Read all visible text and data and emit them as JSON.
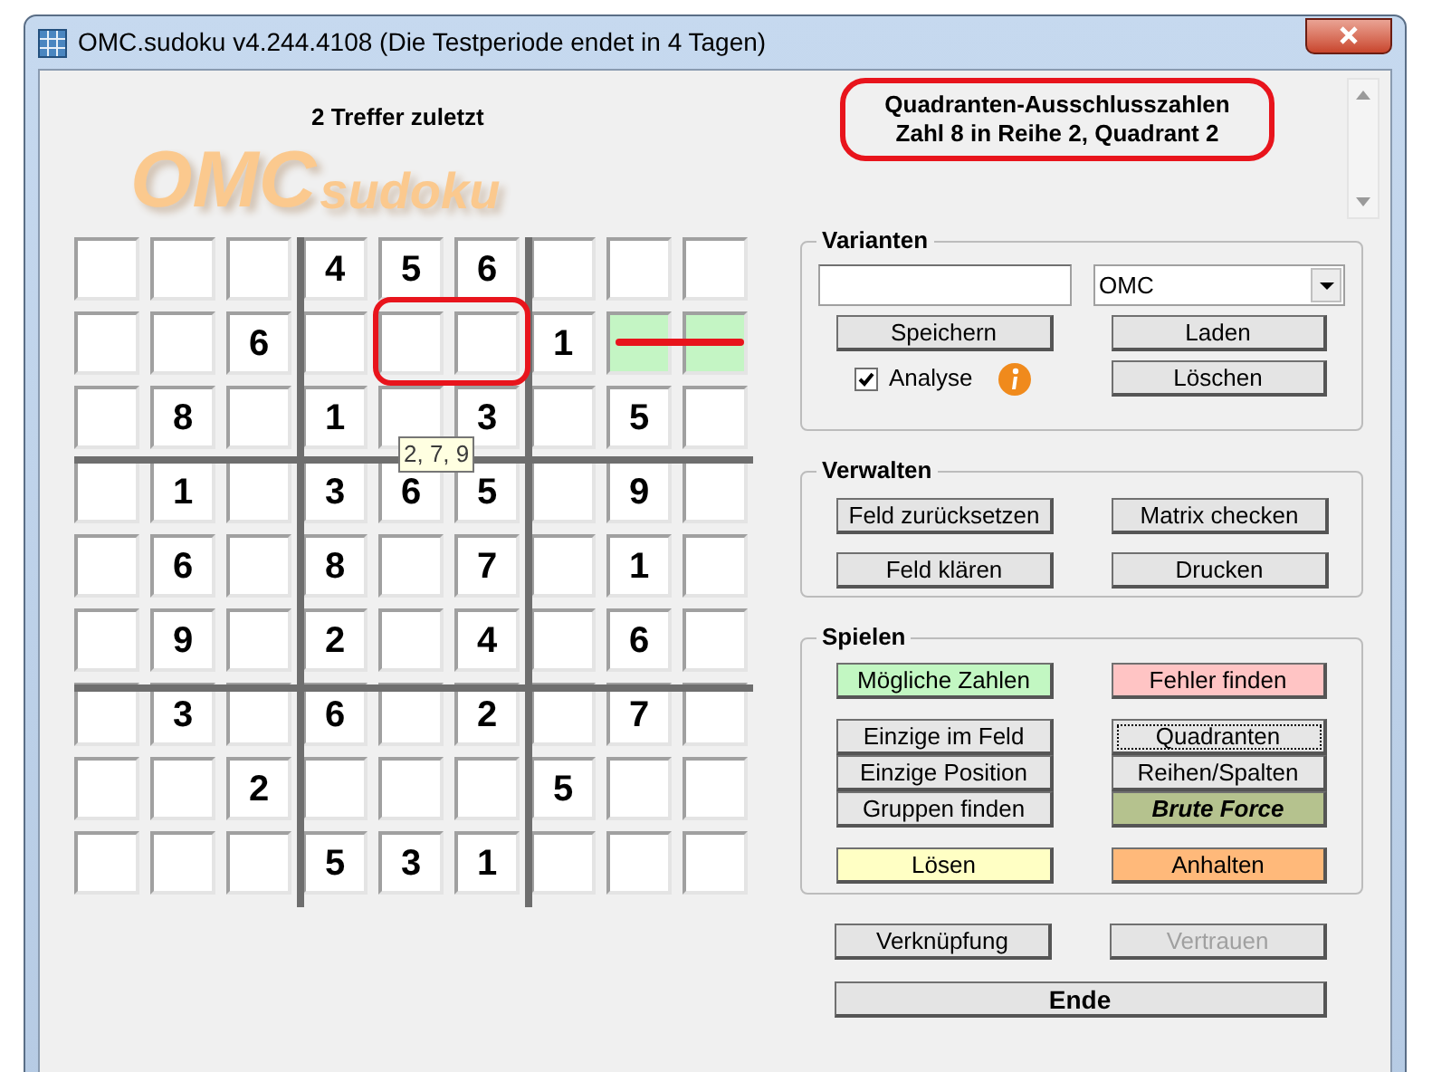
{
  "window": {
    "title": "OMC.sudoku v4.244.4108 (Die Testperiode endet in 4 Tagen)"
  },
  "logo": {
    "part_1": "OMC",
    "part_2": "sudoku"
  },
  "hits": "2 Treffer zuletzt",
  "message": {
    "line_1": "Quadranten-Ausschlusszahlen",
    "line_2": "Zahl 8 in Reihe 2, Quadrant 2"
  },
  "grid": {
    "rows": [
      [
        {
          "highlighted": false
        },
        {
          "highlighted": false
        },
        {
          "highlighted": false
        },
        {
          "value": "4",
          "highlighted": false
        },
        {
          "value": "5",
          "highlighted": false
        },
        {
          "value": "6",
          "highlighted": false
        },
        {
          "highlighted": false
        },
        {
          "highlighted": false
        },
        {
          "highlighted": false
        }
      ],
      [
        {
          "highlighted": false
        },
        {
          "highlighted": false
        },
        {
          "value": "6",
          "highlighted": false
        },
        {
          "highlighted": false
        },
        {
          "highlighted": false
        },
        {
          "highlighted": false
        },
        {
          "value": "1",
          "highlighted": false
        },
        {
          "highlighted": true
        },
        {
          "highlighted": true
        }
      ],
      [
        {
          "highlighted": false
        },
        {
          "value": "8",
          "highlighted": false
        },
        {
          "highlighted": false
        },
        {
          "value": "1",
          "highlighted": false
        },
        {
          "highlighted": false
        },
        {
          "value": "3",
          "highlighted": false
        },
        {
          "highlighted": false
        },
        {
          "value": "5",
          "highlighted": false
        },
        {
          "highlighted": false
        }
      ],
      [
        {
          "highlighted": false
        },
        {
          "value": "1",
          "highlighted": false
        },
        {
          "highlighted": false
        },
        {
          "value": "3",
          "highlighted": false
        },
        {
          "value": "6",
          "highlighted": false
        },
        {
          "value": "5",
          "highlighted": false
        },
        {
          "highlighted": false
        },
        {
          "value": "9",
          "highlighted": false
        },
        {
          "highlighted": false
        }
      ],
      [
        {
          "highlighted": false
        },
        {
          "value": "6",
          "highlighted": false
        },
        {
          "highlighted": false
        },
        {
          "value": "8",
          "highlighted": false
        },
        {
          "highlighted": false
        },
        {
          "value": "7",
          "highlighted": false
        },
        {
          "highlighted": false
        },
        {
          "value": "1",
          "highlighted": false
        },
        {
          "highlighted": false
        }
      ],
      [
        {
          "highlighted": false
        },
        {
          "value": "9",
          "highlighted": false
        },
        {
          "highlighted": false
        },
        {
          "value": "2",
          "highlighted": false
        },
        {
          "highlighted": false
        },
        {
          "value": "4",
          "highlighted": false
        },
        {
          "highlighted": false
        },
        {
          "value": "6",
          "highlighted": false
        },
        {
          "highlighted": false
        }
      ],
      [
        {
          "highlighted": false
        },
        {
          "value": "3",
          "highlighted": false
        },
        {
          "highlighted": false
        },
        {
          "value": "6",
          "highlighted": false
        },
        {
          "highlighted": false
        },
        {
          "value": "2",
          "highlighted": false
        },
        {
          "highlighted": false
        },
        {
          "value": "7",
          "highlighted": false
        },
        {
          "highlighted": false
        }
      ],
      [
        {
          "highlighted": false
        },
        {
          "highlighted": false
        },
        {
          "value": "2",
          "highlighted": false
        },
        {
          "highlighted": false
        },
        {
          "highlighted": false
        },
        {
          "highlighted": false
        },
        {
          "value": "5",
          "highlighted": false
        },
        {
          "highlighted": false
        },
        {
          "highlighted": false
        }
      ],
      [
        {
          "highlighted": false
        },
        {
          "highlighted": false
        },
        {
          "highlighted": false
        },
        {
          "value": "5",
          "highlighted": false
        },
        {
          "value": "3",
          "highlighted": false
        },
        {
          "value": "1",
          "highlighted": false
        },
        {
          "highlighted": false
        },
        {
          "highlighted": false
        },
        {
          "highlighted": false
        }
      ]
    ],
    "tooltip": "2, 7, 9"
  },
  "varianten": {
    "title": "Varianten",
    "dropdown": {
      "value": "OMC"
    },
    "buttons": [
      {
        "label": "Speichern"
      },
      {
        "label": "Laden"
      },
      {
        "label": "Löschen"
      }
    ],
    "analyse": {
      "label": "Analyse",
      "checked": true
    }
  },
  "verwalten": {
    "title": "Verwalten",
    "buttons": [
      {
        "label": "Feld zurücksetzen"
      },
      {
        "label": "Matrix checken"
      },
      {
        "label": "Feld klären"
      },
      {
        "label": "Drucken"
      }
    ]
  },
  "spielen": {
    "title": "Spielen",
    "groups": [
      {
        "rows": [
          [
            {
              "label": "Mögliche Zahlen",
              "color": "#c2f7c2",
              "kind": "plain",
              "focused": false
            },
            {
              "label": "Fehler finden",
              "color": "#ffc4c4",
              "kind": "plain",
              "focused": false
            }
          ]
        ]
      },
      {
        "rows": [
          [
            {
              "label": "Einzige im Feld",
              "color": "#e6e6e6",
              "kind": "plain",
              "focused": false
            },
            {
              "label": "Quadranten",
              "color": "#e6e6e6",
              "kind": "plain",
              "focused": true
            }
          ],
          [
            {
              "label": "Einzige Position",
              "color": "#e6e6e6",
              "kind": "plain",
              "focused": false
            },
            {
              "label": "Reihen/Spalten",
              "color": "#e6e6e6",
              "kind": "plain",
              "focused": false
            }
          ],
          [
            {
              "label": "Gruppen finden",
              "color": "#e6e6e6",
              "kind": "plain",
              "focused": false
            },
            {
              "label": "Brute Force",
              "color": "#b5c28e",
              "kind": "bold-italic",
              "focused": false
            }
          ]
        ]
      },
      {
        "rows": [
          [
            {
              "label": "Lösen",
              "color": "#ffffc4",
              "kind": "plain",
              "focused": false
            },
            {
              "label": "Anhalten",
              "color": "#ffb97a",
              "kind": "plain",
              "focused": false
            }
          ]
        ]
      }
    ]
  },
  "bottom_buttons": [
    {
      "label": "Verknüpfung",
      "disabled": false
    },
    {
      "label": "Vertrauen",
      "disabled": true
    }
  ],
  "end_button": {
    "label": "Ende"
  }
}
